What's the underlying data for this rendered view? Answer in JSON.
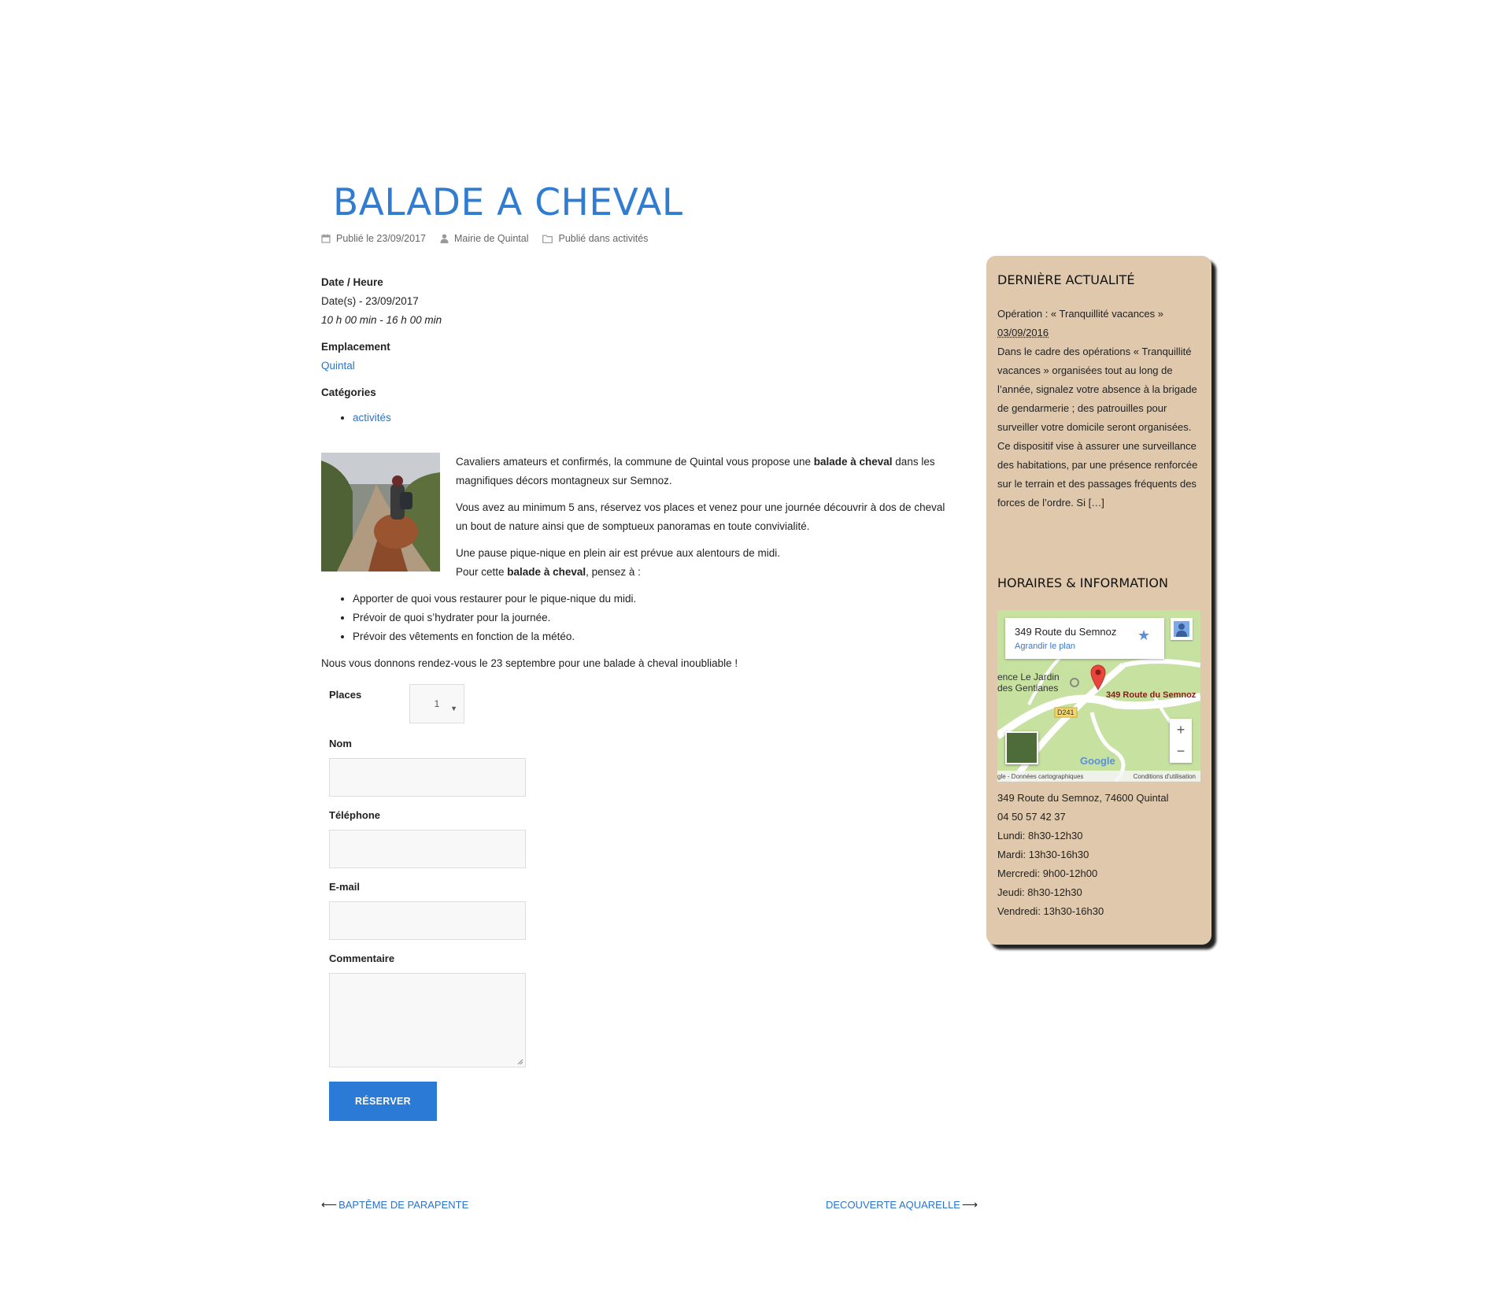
{
  "post": {
    "title": "BALADE A CHEVAL",
    "published": "Publié le 23/09/2017",
    "author": "Mairie de Quintal",
    "category_meta": "Publié dans activités"
  },
  "event": {
    "date_heading": "Date / Heure",
    "dates": "Date(s) - 23/09/2017",
    "time": "10 h 00 min - 16 h 00 min",
    "location_heading": "Emplacement",
    "location": "Quintal",
    "categories_heading": "Catégories",
    "categories": [
      "activités"
    ]
  },
  "body": {
    "p1_a": "Cavaliers amateurs et confirmés, la commune de Quintal vous propose une ",
    "p1_b": "balade à cheval",
    "p1_c": " dans les magnifiques décors montagneux sur Semnoz.",
    "p2": "Vous avez au minimum 5 ans, réservez vos places et venez pour une journée découvrir à dos de cheval un bout de nature ainsi que de somptueux panoramas en toute convivialité.",
    "p3": "Une pause pique-nique en plein air est prévue aux alentours de midi.",
    "p4_a": "Pour cette ",
    "p4_b": "balade à cheval",
    "p4_c": ", pensez à :",
    "tips": [
      "Apporter de quoi vous restaurer pour le pique-nique du midi.",
      "Prévoir de quoi s’hydrater pour la journée.",
      "Prévoir des vêtements en fonction de la météo."
    ],
    "closing": "Nous vous donnons rendez-vous le 23 septembre pour une balade à cheval inoubliable !"
  },
  "form": {
    "places_label": "Places",
    "places_value": "1",
    "name_label": "Nom",
    "phone_label": "Téléphone",
    "email_label": "E-mail",
    "comment_label": "Commentaire",
    "submit_label": "RÉSERVER"
  },
  "nav": {
    "prev": "BAPTÊME DE PARAPENTE",
    "next": "DECOUVERTE AQUARELLE"
  },
  "sidebar": {
    "news_heading": "DERNIÈRE ACTUALITÉ",
    "news_title": "Opération : « Tranquillité vacances »",
    "news_date": "03/09/2016",
    "news_excerpt": "Dans le cadre des opérations « Tranquillité vacances » organisées tout au long de l’année, signalez votre absence à la brigade de gendarmerie ; des patrouilles pour surveiller votre domicile seront organisées. Ce dispositif vise à assurer une surveillance des habitations, par une présence renforcée sur le terrain et des passages fréquents des forces de l’ordre. Si […]",
    "info_heading": "HORAIRES & INFORMATION",
    "map": {
      "card_title": "349 Route du Semnoz",
      "card_link": "Agrandir le plan",
      "place_label_1": "ence Le Jardin",
      "place_label_2": "des Gentianes",
      "marker_label": "349 Route du Semnoz",
      "road": "D241",
      "google": "Google",
      "attribution": "gle - Données cartographiques",
      "terms": "Conditions d'utilisation",
      "zoom_in": "+",
      "zoom_out": "−"
    },
    "address": "349 Route du Semnoz, 74600 Quintal",
    "phone": "04 50 57 42 37",
    "hours": [
      "Lundi: 8h30-12h30",
      "Mardi: 13h30-16h30",
      "Mercredi: 9h00-12h00",
      "Jeudi: 8h30-12h30",
      "Vendredi: 13h30-16h30"
    ],
    "colors": {
      "panel": "#dfc8ac",
      "accent": "#2f7cd1"
    }
  }
}
